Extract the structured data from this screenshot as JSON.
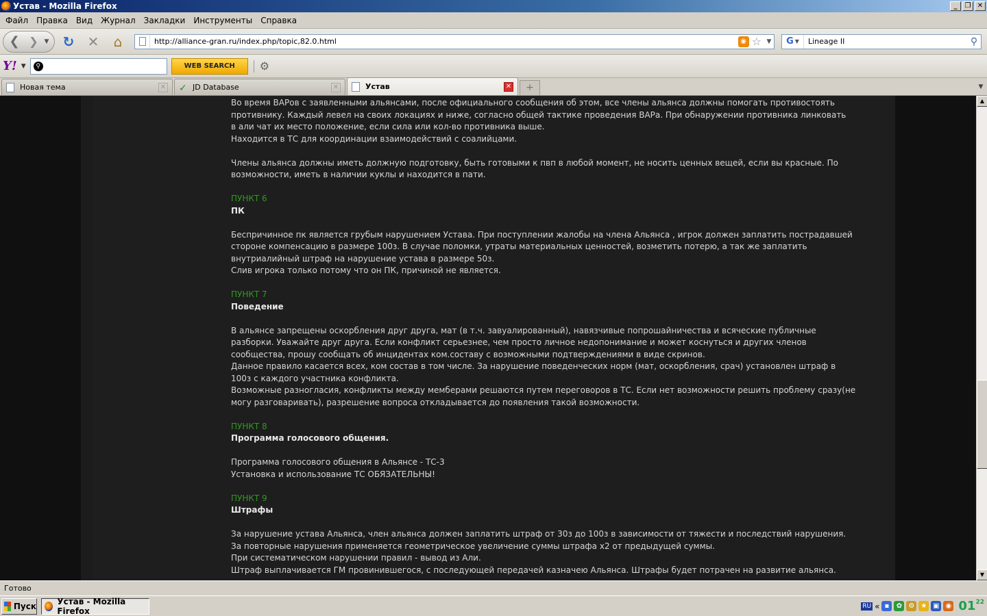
{
  "window": {
    "title": "Устав - Mozilla Firefox",
    "buttons": [
      "_",
      "❐",
      "✕"
    ]
  },
  "menu": [
    "Файл",
    "Правка",
    "Вид",
    "Журнал",
    "Закладки",
    "Инструменты",
    "Справка"
  ],
  "navbar": {
    "back_icon": "back-arrow-icon",
    "forward_icon": "forward-arrow-icon",
    "url": "http://alliance-gran.ru/index.php/topic,82.0.html",
    "search_value": "Lineage II"
  },
  "yahoo": {
    "logo": "Y!",
    "search_placeholder": "",
    "button_label": "WEB SEARCH"
  },
  "tabs": [
    {
      "label": "Новая тема",
      "active": false
    },
    {
      "label": "JD Database",
      "active": false
    },
    {
      "label": "Устав",
      "active": true
    }
  ],
  "content": {
    "lines": [
      {
        "type": "text",
        "text": "Во время ВАРов с заявленными альянсами, после официального сообщения об этом, все члены альянса должны помогать противостоять"
      },
      {
        "type": "text",
        "text": "противнику. Каждый левел на своих локациях и ниже, согласно общей тактике проведения ВАРа. При обнаружении противника линковать"
      },
      {
        "type": "text",
        "text": "в али чат их место положение, если сила или кол-во противника выше."
      },
      {
        "type": "text",
        "text": "Находится в ТС для координации взаимодействий с соалийцами."
      },
      {
        "type": "gap",
        "text": ""
      },
      {
        "type": "text",
        "text": "Члены альянса должны иметь должную подготовку, быть готовыми к пвп в любой момент, не носить ценных вещей, если вы красные. По"
      },
      {
        "type": "text",
        "text": "возможности, иметь в наличии куклы и находится в пати."
      },
      {
        "type": "gap",
        "text": ""
      },
      {
        "type": "punkt",
        "text": "ПУНКТ 6"
      },
      {
        "type": "subhead",
        "text": "ПК"
      },
      {
        "type": "gap",
        "text": ""
      },
      {
        "type": "text",
        "text": "Беспричинное пк является грубым нарушением Устава. При поступлении жалобы на члена Альянса , игрок должен заплатить пострадавшей"
      },
      {
        "type": "text",
        "text": "стороне компенсацию в размере 100з. В случае поломки, утраты материальных ценностей, возметить потерю, а так же  заплатить"
      },
      {
        "type": "text",
        "text": "внутриалийный штраф на нарушение устава в размере 50з."
      },
      {
        "type": "text",
        "text": "Слив игрока только потому что он ПК, причиной не является."
      },
      {
        "type": "gap",
        "text": ""
      },
      {
        "type": "punkt",
        "text": "ПУНКТ 7"
      },
      {
        "type": "subhead",
        "text": "Поведение"
      },
      {
        "type": "gap",
        "text": ""
      },
      {
        "type": "text",
        "text": "В альянсе запрещены оскорбления друг друга, мат (в т.ч. завуалированный), навязчивые попрошайничества и всяческие публичные"
      },
      {
        "type": "text",
        "text": "разборки. Уважайте друг друга. Если конфликт серьезнее, чем просто личное недопонимание и может коснуться и других членов"
      },
      {
        "type": "text",
        "text": "сообщества, прошу сообщать об инцидентах ком.составу с возможными подтверждениями в виде скринов."
      },
      {
        "type": "text",
        "text": "Данное правило касается всех, ком состав в том числе. За нарушение поведенческих норм (мат, оскорбления, срач) установлен штраф в"
      },
      {
        "type": "text",
        "text": "100з с каждого участника конфликта."
      },
      {
        "type": "text",
        "text": "Возможные разногласия, конфликты между мемберами решаются путем переговоров в ТС. Если нет возможности решить проблему сразу(не"
      },
      {
        "type": "text",
        "text": "могу разговаривать), разрешение вопроса откладывается до появления такой возможности."
      },
      {
        "type": "gap",
        "text": ""
      },
      {
        "type": "punkt",
        "text": "ПУНКТ 8"
      },
      {
        "type": "subhead",
        "text": "Программа голосового общения."
      },
      {
        "type": "gap",
        "text": ""
      },
      {
        "type": "text",
        "text": "Программа голосового общения в Альянсе - ТС-3"
      },
      {
        "type": "text",
        "text": "Установка и использование ТС ОБЯЗАТЕЛЬНЫ!"
      },
      {
        "type": "gap",
        "text": ""
      },
      {
        "type": "punkt",
        "text": "ПУНКТ 9"
      },
      {
        "type": "subhead",
        "text": "Штрафы"
      },
      {
        "type": "gap",
        "text": ""
      },
      {
        "type": "text",
        "text": "За нарушение устава Альянса, член альянса должен заплатить штраф от 30з до 100з в зависимости от тяжести и последствий нарушения."
      },
      {
        "type": "text",
        "text": "За повторные нарушения применяется геометрическое увеличение суммы штрафа х2 от предыдущей суммы."
      },
      {
        "type": "text",
        "text": "При систематическом нарушении правил - вывод из Али."
      },
      {
        "type": "text",
        "text": "Штраф выплачивается ГМ провинившегося, с последующей передачей казначею Альянса. Штрафы будет потрачен на развитие альянса."
      }
    ]
  },
  "status": {
    "text": "Готово"
  },
  "taskbar": {
    "start_label": "Пуск",
    "task_label": "Устав - Mozilla Firefox",
    "lang": "RU",
    "clock_hours": "01",
    "clock_minutes": "22"
  },
  "colors": {
    "page_bg": "#1e1e1e",
    "text": "#d6d6d6",
    "punkt": "#2f9a1e"
  }
}
